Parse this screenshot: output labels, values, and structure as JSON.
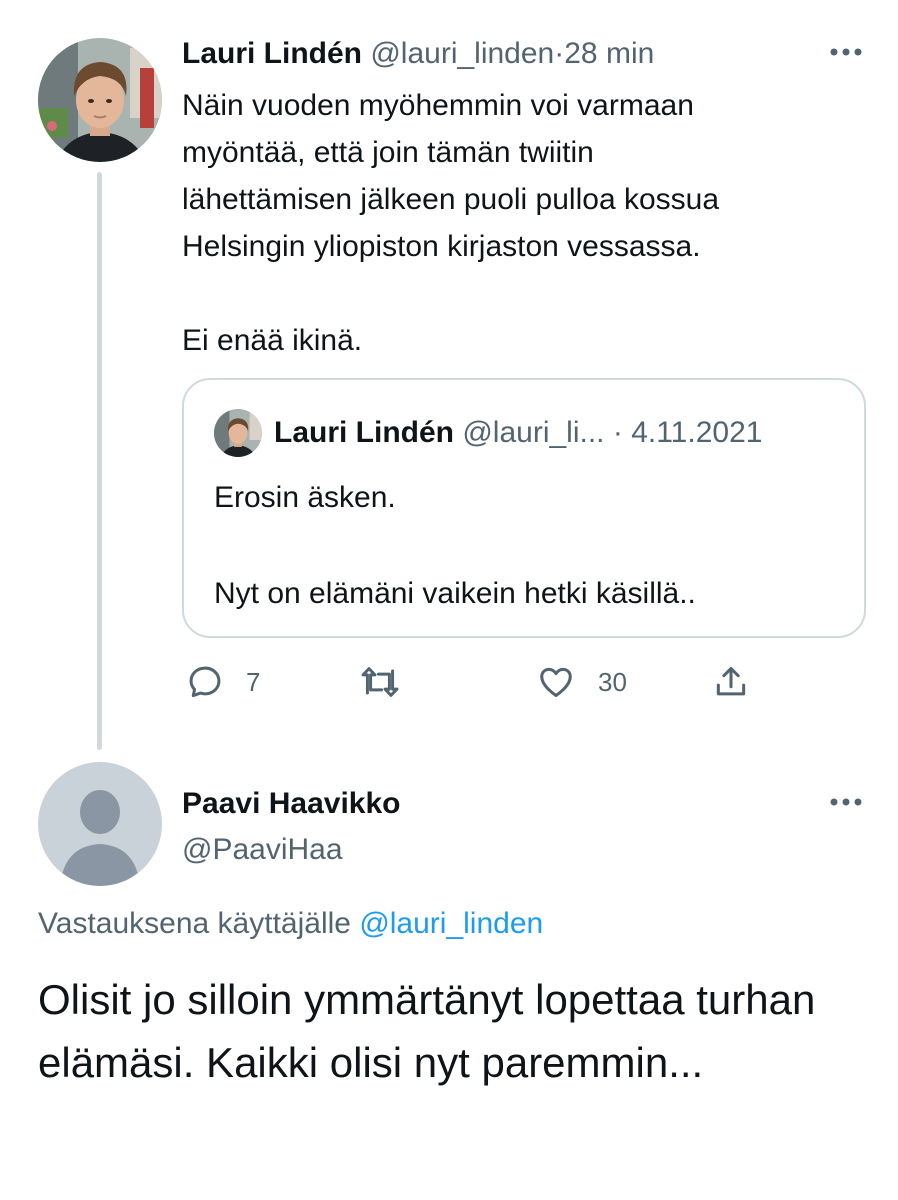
{
  "tweet": {
    "author_name": "Lauri Lindén",
    "author_handle": "@lauri_linden",
    "separator": "·",
    "time": "28 min",
    "text_lines": [
      "Näin vuoden myöhemmin voi varmaan",
      "myöntää, että join tämän twiitin",
      "lähettämisen jälkeen puoli pulloa kossua",
      "Helsingin yliopiston kirjaston vessassa.",
      "Ei enää ikinä."
    ],
    "quote": {
      "author_name": "Lauri Lindén",
      "author_handle": "@lauri_li...",
      "separator": "·",
      "date": "4.11.2021",
      "text_lines": [
        "Erosin äsken.",
        "Nyt on elämäni vaikein hetki käsillä.."
      ]
    },
    "actions": {
      "reply_icon": "speech-bubble-icon",
      "reply_count": "7",
      "retweet_icon": "retweet-icon",
      "like_icon": "heart-icon",
      "like_count": "30",
      "share_icon": "share-icon"
    }
  },
  "reply": {
    "author_name": "Paavi Haavikko",
    "author_handle": "@PaaviHaa",
    "replying_to_label": "Vastauksena käyttäjälle",
    "replying_to_handle": "@lauri_linden",
    "text": "Olisit jo silloin ymmärtänyt lopettaa turhan elämäsi. Kaikki olisi nyt paremmin..."
  },
  "colors": {
    "text": "#0f1419",
    "muted": "#536471",
    "link": "#1d9bf0",
    "border": "#cfd9de",
    "default_avatar_bg": "#c9d1d9",
    "default_avatar_fg": "#8a96a3"
  }
}
